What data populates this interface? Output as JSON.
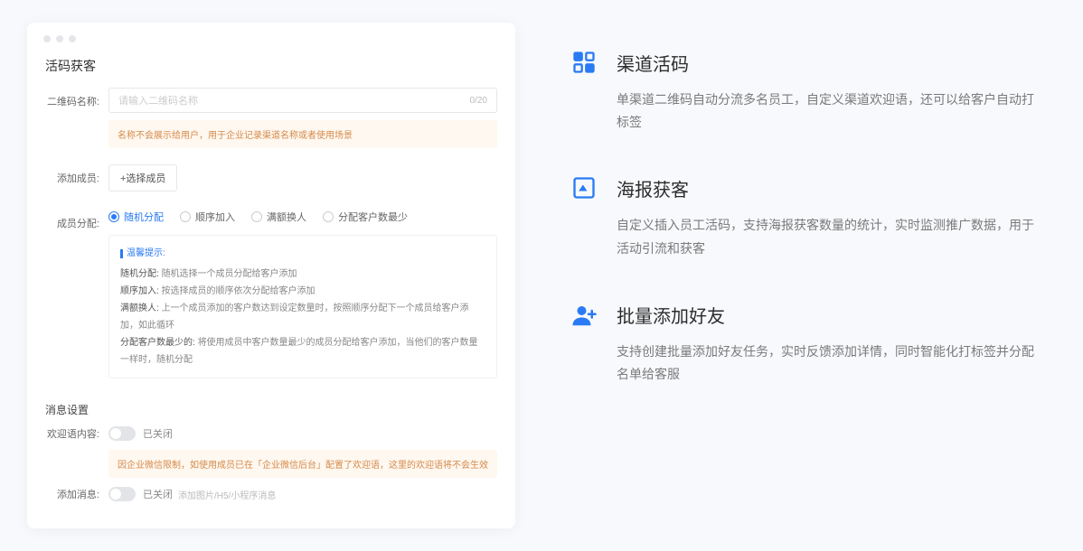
{
  "panel": {
    "title": "活码获客",
    "qrcode_name_label": "二维码名称:",
    "qrcode_placeholder": "请输入二维码名称",
    "qrcode_counter": "0/20",
    "qrcode_name_hint": "名称不会展示给用户，用于企业记录渠道名称或者使用场景",
    "add_member_label": "添加成员:",
    "add_member_btn": "+选择成员",
    "assign_label": "成员分配:",
    "assign_options": {
      "random": "随机分配",
      "sequential": "顺序加入",
      "overflow": "满额换人",
      "least": "分配客户数最少"
    },
    "tips": {
      "title": "温馨提示:",
      "random": {
        "label": "随机分配:",
        "text": "随机选择一个成员分配给客户添加"
      },
      "sequential": {
        "label": "顺序加入:",
        "text": "按选择成员的顺序依次分配给客户添加"
      },
      "overflow": {
        "label": "满额换人:",
        "text": "上一个成员添加的客户数达到设定数量时，按照顺序分配下一个成员给客户添加，如此循环"
      },
      "least": {
        "label": "分配客户数最少的:",
        "text": "将使用成员中客户数量最少的成员分配给客户添加，当他们的客户数量一样时，随机分配"
      }
    },
    "msg_section": "消息设置",
    "welcome_label": "欢迎语内容:",
    "welcome_state": "已关闭",
    "welcome_hint": "因企业微信限制，如使用成员已在「企业微信后台」配置了欢迎语，这里的欢迎语将不会生效",
    "addmsg_label": "添加消息:",
    "addmsg_state": "已关闭",
    "addmsg_extra": "添加图片/H5/小程序消息"
  },
  "features": [
    {
      "icon": "grid",
      "title": "渠道活码",
      "desc": "单渠道二维码自动分流多名员工，自定义渠道欢迎语，还可以给客户自动打标签"
    },
    {
      "icon": "image",
      "title": "海报获客",
      "desc": "自定义插入员工活码，支持海报获客数量的统计，实时监测推广数据，用于活动引流和获客"
    },
    {
      "icon": "user-plus",
      "title": "批量添加好友",
      "desc": "支持创建批量添加好友任务，实时反馈添加详情，同时智能化打标签并分配名单给客服"
    }
  ]
}
